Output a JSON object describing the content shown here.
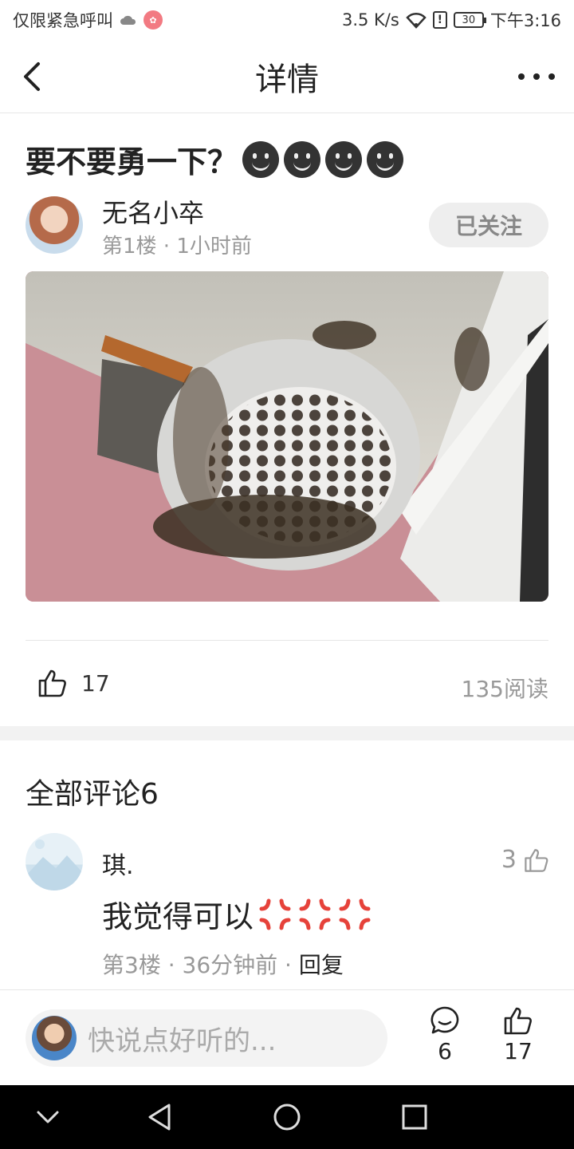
{
  "status_bar": {
    "carrier": "仅限紧急呼叫",
    "speed": "3.5 K/s",
    "battery": "30",
    "time": "下午3:16"
  },
  "header": {
    "title": "详情"
  },
  "post": {
    "title": "要不要勇一下？",
    "author": "无名小卒",
    "meta": "第1楼 · 1小时前",
    "follow_label": "已关注",
    "likes": "17",
    "reads": "135阅读"
  },
  "comments": {
    "title": "全部评论6",
    "items": [
      {
        "name": "琪.",
        "likes": "3",
        "text": "我觉得可以",
        "meta": "第3楼 · 36分钟前 · ",
        "reply_label": "回复"
      }
    ]
  },
  "bottom_bar": {
    "placeholder": "快说点好听的...",
    "comment_count": "6",
    "like_count": "17"
  },
  "icons": {
    "back": "chevron-left-icon",
    "more": "more-dots-icon",
    "like": "thumb-up-icon",
    "comment": "speech-bubble-icon"
  },
  "colors": {
    "follow_bg": "#eeeeee",
    "muted_text": "#999999",
    "section_gap": "#f2f2f2"
  }
}
